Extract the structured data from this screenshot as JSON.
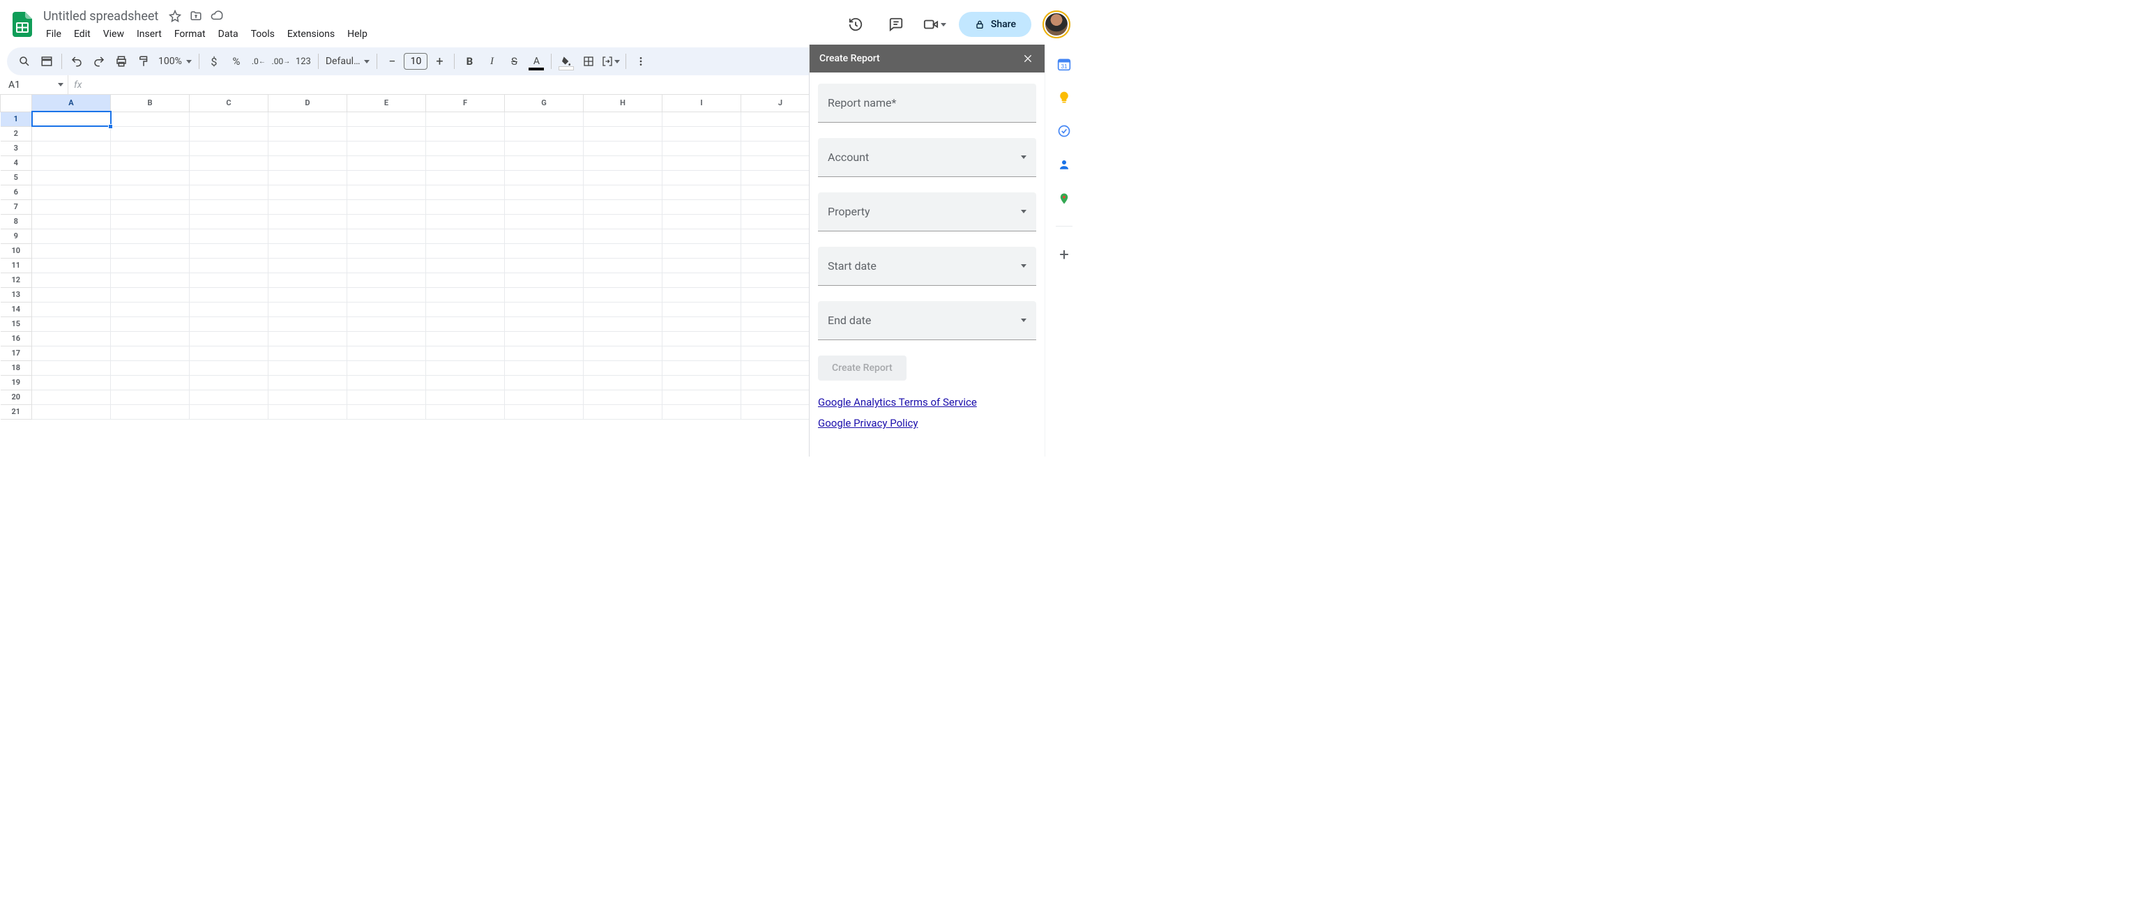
{
  "doc": {
    "title": "Untitled spreadsheet"
  },
  "menus": [
    "File",
    "Edit",
    "View",
    "Insert",
    "Format",
    "Data",
    "Tools",
    "Extensions",
    "Help"
  ],
  "toolbar": {
    "zoom": "100%",
    "font": "Defaul…",
    "font_size": "10"
  },
  "share": {
    "label": "Share"
  },
  "namebox": {
    "value": "A1"
  },
  "columns": [
    "A",
    "B",
    "C",
    "D",
    "E",
    "F",
    "G",
    "H",
    "I",
    "J"
  ],
  "rows": [
    "1",
    "2",
    "3",
    "4",
    "5",
    "6",
    "7",
    "8",
    "9",
    "10",
    "11",
    "12",
    "13",
    "14",
    "15",
    "16",
    "17",
    "18",
    "19",
    "20",
    "21"
  ],
  "selected_cell": "A1",
  "panel": {
    "title": "Create Report",
    "fields": {
      "report_name": "Report name*",
      "account": "Account",
      "property": "Property",
      "start_date": "Start date",
      "end_date": "End date"
    },
    "button": "Create Report",
    "link_tos": "Google Analytics Terms of Service",
    "link_privacy": "Google Privacy Policy"
  },
  "rail": {
    "calendar_day": "31"
  }
}
